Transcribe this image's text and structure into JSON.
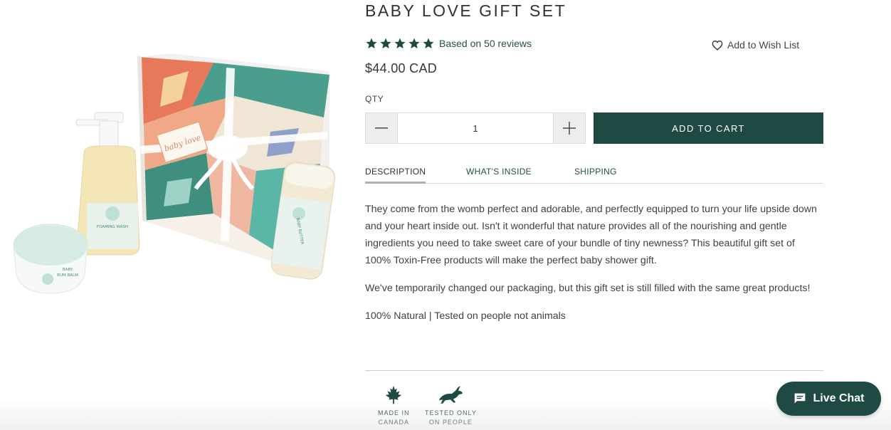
{
  "product": {
    "title": "BABY LOVE GIFT SET",
    "rating_stars": 5,
    "reviews_text": "Based on 50 reviews",
    "price": "$44.00 CAD",
    "image_alt_icon": "product-photo"
  },
  "wishlist": {
    "label": "Add to Wish List",
    "icon": "heart-icon"
  },
  "quantity": {
    "label": "QTY",
    "value": "1",
    "decrement_icon": "minus-icon",
    "increment_icon": "plus-icon"
  },
  "cart": {
    "button_label": "ADD TO CART"
  },
  "tabs": [
    {
      "label": "DESCRIPTION",
      "active": true
    },
    {
      "label": "WHAT'S INSIDE",
      "active": false
    },
    {
      "label": "SHIPPING",
      "active": false
    }
  ],
  "description": {
    "paragraphs": [
      "They come from the womb perfect and adorable, and perfectly equipped to turn your life upside down and your heart inside out. Isn't it wonderful that nature provides all of the nourishing and gentle ingredients you need to take sweet care of your bundle of tiny newness? This beautiful gift set of 100% Toxin-Free products will make the perfect baby shower gift.",
      "We've temporarily changed our packaging, but this gift set is still filled with the same great products!",
      "100% Natural | Tested on people not animals"
    ]
  },
  "badges": [
    {
      "line1": "MADE IN",
      "line2": "CANADA",
      "icon": "maple-leaf-icon"
    },
    {
      "line1": "TESTED ONLY",
      "line2": "ON PEOPLE",
      "icon": "rabbit-icon"
    }
  ],
  "live_chat": {
    "label": "Live Chat",
    "icon": "chat-bubble-icon"
  },
  "image_text": {
    "box_tag": "baby love",
    "foaming_wash": "FOAMING WASH",
    "baby_butter": "BABY BUTTER",
    "bum_balm_line1": "BABY",
    "bum_balm_line2": "BUM BALM"
  },
  "colors": {
    "brand_green": "#1f4a44",
    "link_green": "#24514a",
    "text": "#3a4443"
  }
}
